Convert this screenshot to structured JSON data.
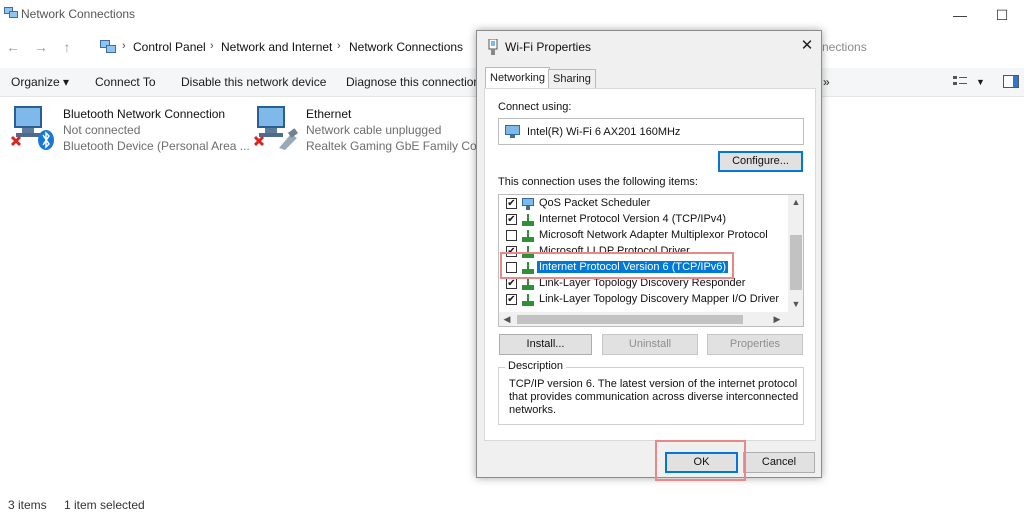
{
  "window": {
    "title": "Network Connections",
    "minimize_glyph": "—",
    "maximize_glyph": "☐"
  },
  "nav": {
    "back_glyph": "←",
    "forward_glyph": "→",
    "up_glyph": "↑",
    "breadcrumbs": [
      "Control Panel",
      "Network and Internet",
      "Network Connections"
    ],
    "search_partial": "nections"
  },
  "toolbar": {
    "organize": "Organize ▾",
    "connect_to": "Connect To",
    "disable": "Disable this network device",
    "diagnose": "Diagnose this connection",
    "overflow": "»"
  },
  "connections": [
    {
      "name": "Bluetooth Network Connection",
      "status": "Not connected",
      "device": "Bluetooth Device (Personal Area ..."
    },
    {
      "name": "Ethernet",
      "status": "Network cable unplugged",
      "device": "Realtek Gaming GbE Family Contr..."
    }
  ],
  "status_bar": {
    "items": "3 items",
    "selected": "1 item selected"
  },
  "dialog": {
    "title": "Wi-Fi Properties",
    "close_glyph": "✕",
    "tabs": [
      "Networking",
      "Sharing"
    ],
    "connect_using_label": "Connect using:",
    "adapter": "Intel(R) Wi-Fi 6 AX201 160MHz",
    "configure": "Configure...",
    "items_label": "This connection uses the following items:",
    "items": [
      {
        "label": "QoS Packet Scheduler",
        "checked": true
      },
      {
        "label": "Internet Protocol Version 4 (TCP/IPv4)",
        "checked": true
      },
      {
        "label": "Microsoft Network Adapter Multiplexor Protocol",
        "checked": false
      },
      {
        "label": "Microsoft LLDP Protocol Driver",
        "checked": true
      },
      {
        "label": "Internet Protocol Version 6 (TCP/IPv6)",
        "checked": false
      },
      {
        "label": "Link-Layer Topology Discovery Responder",
        "checked": true
      },
      {
        "label": "Link-Layer Topology Discovery Mapper I/O Driver",
        "checked": true
      }
    ],
    "install": "Install...",
    "uninstall": "Uninstall",
    "properties": "Properties",
    "description_label": "Description",
    "description": "TCP/IP version 6. The latest version of the internet protocol that provides communication across diverse interconnected networks.",
    "ok": "OK",
    "cancel": "Cancel"
  },
  "colors": {
    "selection": "#0078d7",
    "highlight": "#e8888a"
  }
}
